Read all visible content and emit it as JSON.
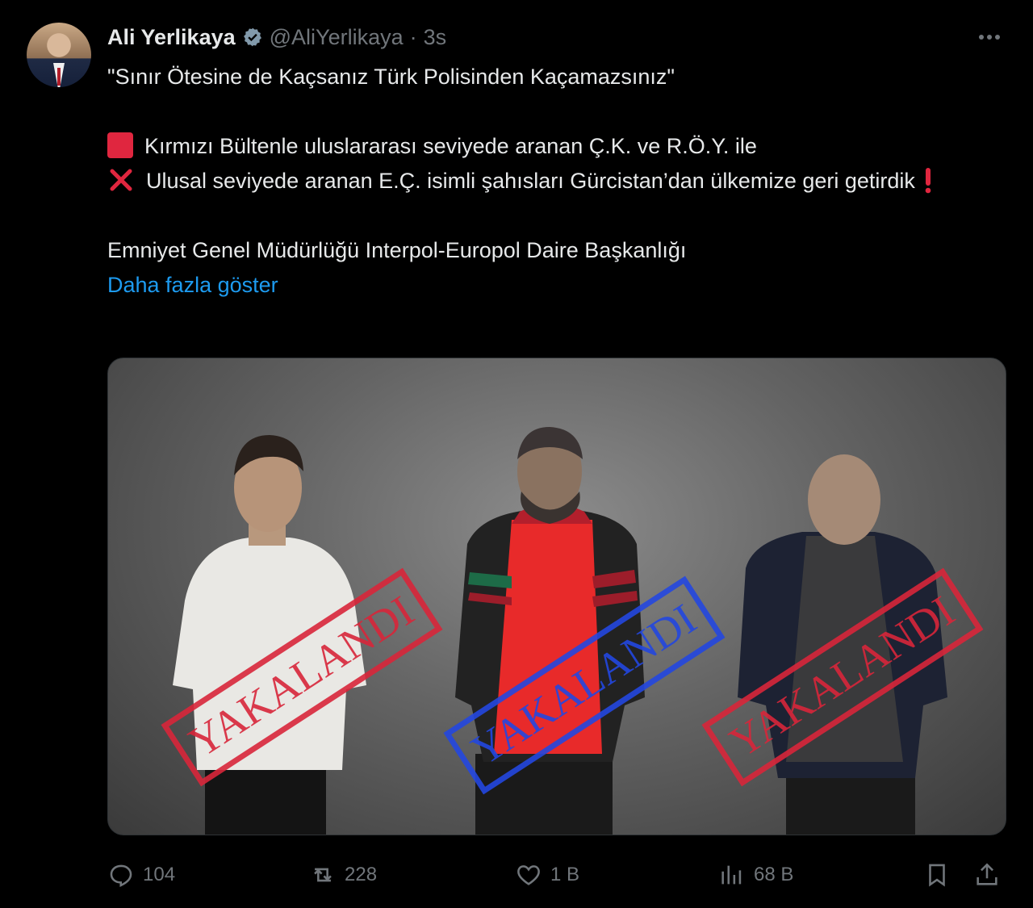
{
  "author": {
    "name": "Ali Yerlikaya",
    "handle": "@AliYerlikaya",
    "separator": "·",
    "time": "3s"
  },
  "tweet": {
    "line1": "\"Sınır Ötesine de Kaçsanız Türk Polisinden Kaçamazsınız\"",
    "line2": "Kırmızı Bültenle uluslararası seviyede aranan Ç.K. ve R.Ö.Y. ile",
    "line3": "Ulusal seviyede aranan E.Ç. isimli şahısları Gürcistan’dan ülkemize geri getirdik",
    "line4": "Emniyet Genel Müdürlüğü Interpol-Europol Daire Başkanlığı",
    "show_more": "Daha fazla göster"
  },
  "media": {
    "stamps": [
      {
        "text": "YAKALANDI",
        "color": "#d8263a"
      },
      {
        "text": "YAKALANDI",
        "color": "#2347e0"
      },
      {
        "text": "YAKALANDI",
        "color": "#d8263a"
      }
    ]
  },
  "actions": {
    "replies": "104",
    "reposts": "228",
    "likes": "1 B",
    "views": "68 B"
  },
  "colors": {
    "background": "#000000",
    "text": "#e7e9ea",
    "muted": "#71767b",
    "link": "#1d9bf0",
    "verified": "#829aab"
  },
  "icons": [
    "verified-icon",
    "more-icon",
    "red-square-icon",
    "cross-mark-icon",
    "exclamation-icon",
    "reply-icon",
    "repost-icon",
    "like-icon",
    "views-icon",
    "bookmark-icon",
    "share-icon"
  ]
}
